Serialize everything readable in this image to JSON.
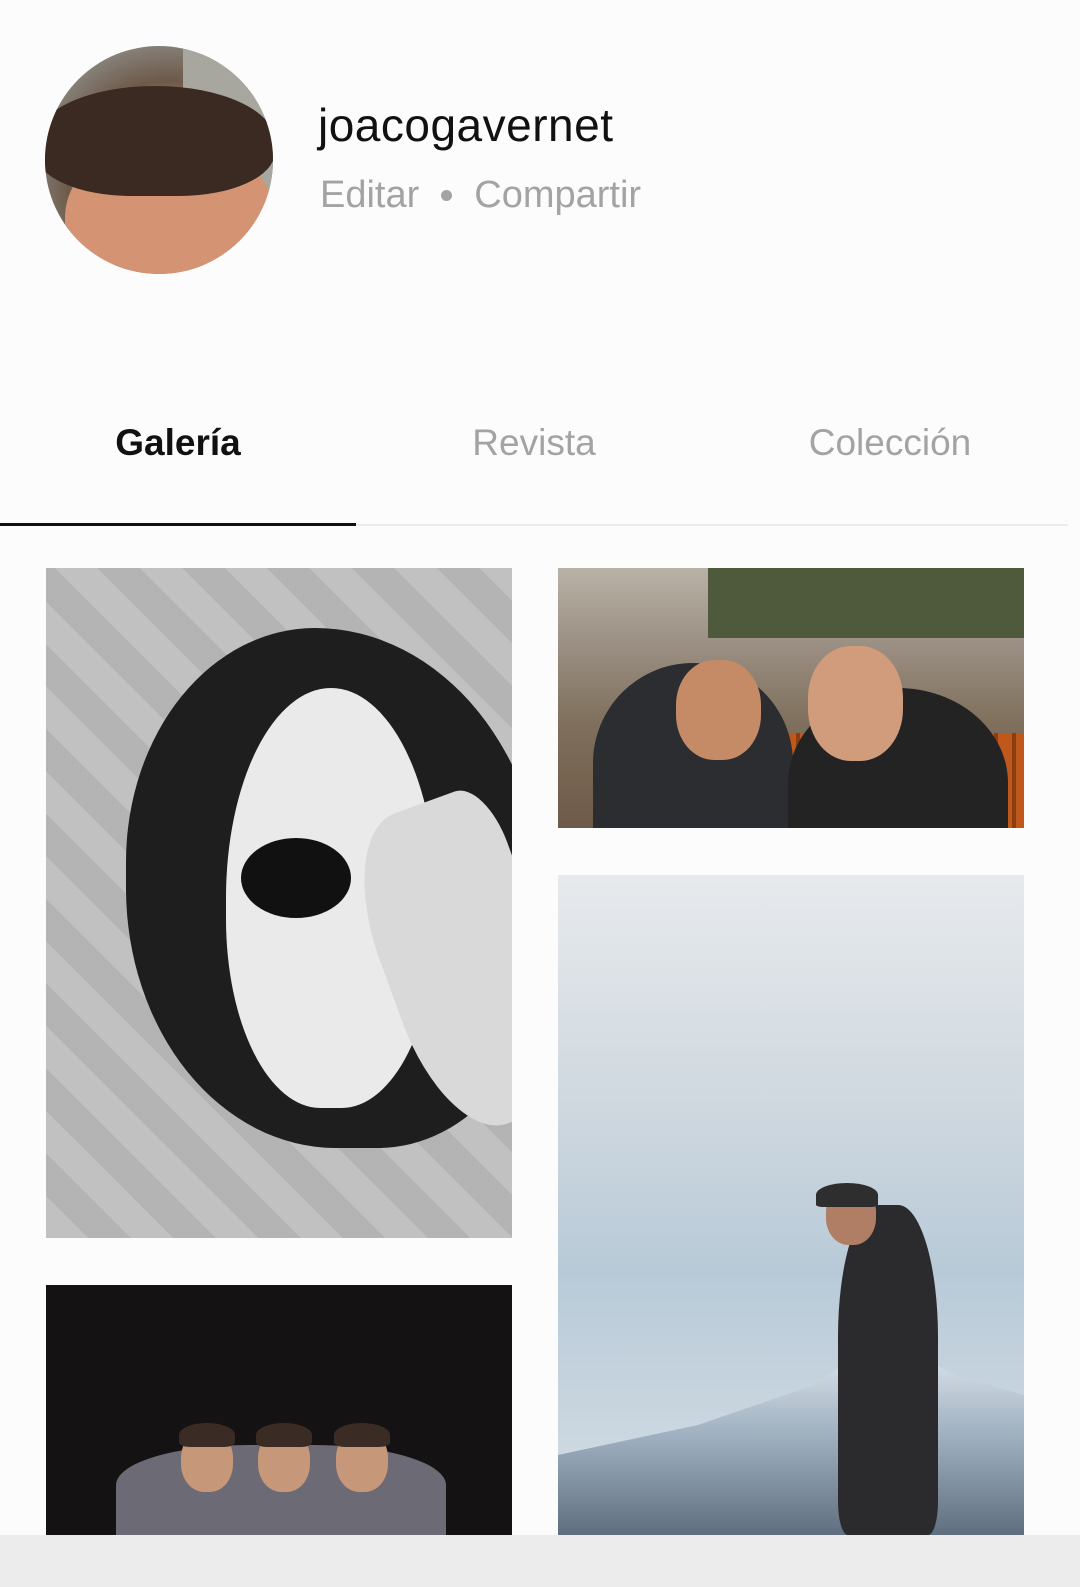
{
  "profile": {
    "username": "joacogavernet",
    "edit_label": "Editar",
    "share_label": "Compartir"
  },
  "tabs": [
    {
      "label": "Galería",
      "active": true
    },
    {
      "label": "Revista",
      "active": false
    },
    {
      "label": "Colección",
      "active": false
    }
  ],
  "colors": {
    "text_primary": "#111111",
    "text_secondary": "#a3a3a3",
    "background": "#fcfcfd"
  }
}
